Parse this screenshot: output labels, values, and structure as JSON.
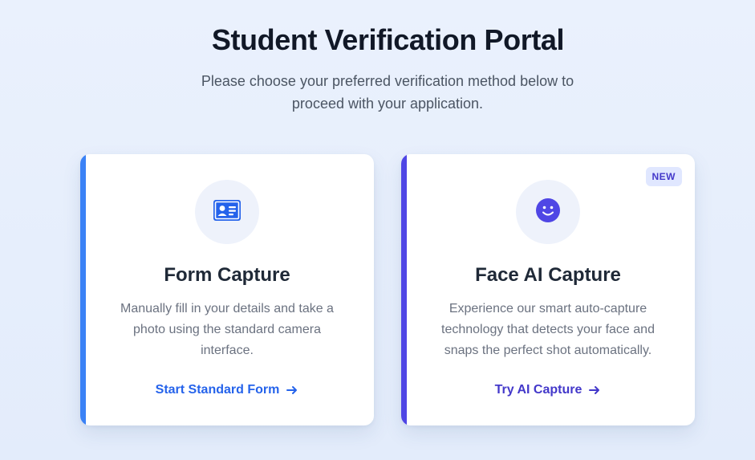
{
  "header": {
    "title": "Student Verification Portal",
    "subtitle": "Please choose your preferred verification method below to proceed with your application."
  },
  "cards": [
    {
      "id": "form",
      "icon": "id-card-icon",
      "title": "Form Capture",
      "description": "Manually fill in your details and take a photo using the standard camera interface.",
      "link_label": "Start Standard Form",
      "accent_color": "#3b82f6",
      "link_color": "#2563eb"
    },
    {
      "id": "face",
      "icon": "smiley-face-icon",
      "badge": "NEW",
      "title": "Face AI Capture",
      "description": "Experience our smart auto-capture technology that detects your face and snaps the perfect shot automatically.",
      "link_label": "Try AI Capture",
      "accent_color": "#4f46e5",
      "link_color": "#4338ca"
    }
  ]
}
